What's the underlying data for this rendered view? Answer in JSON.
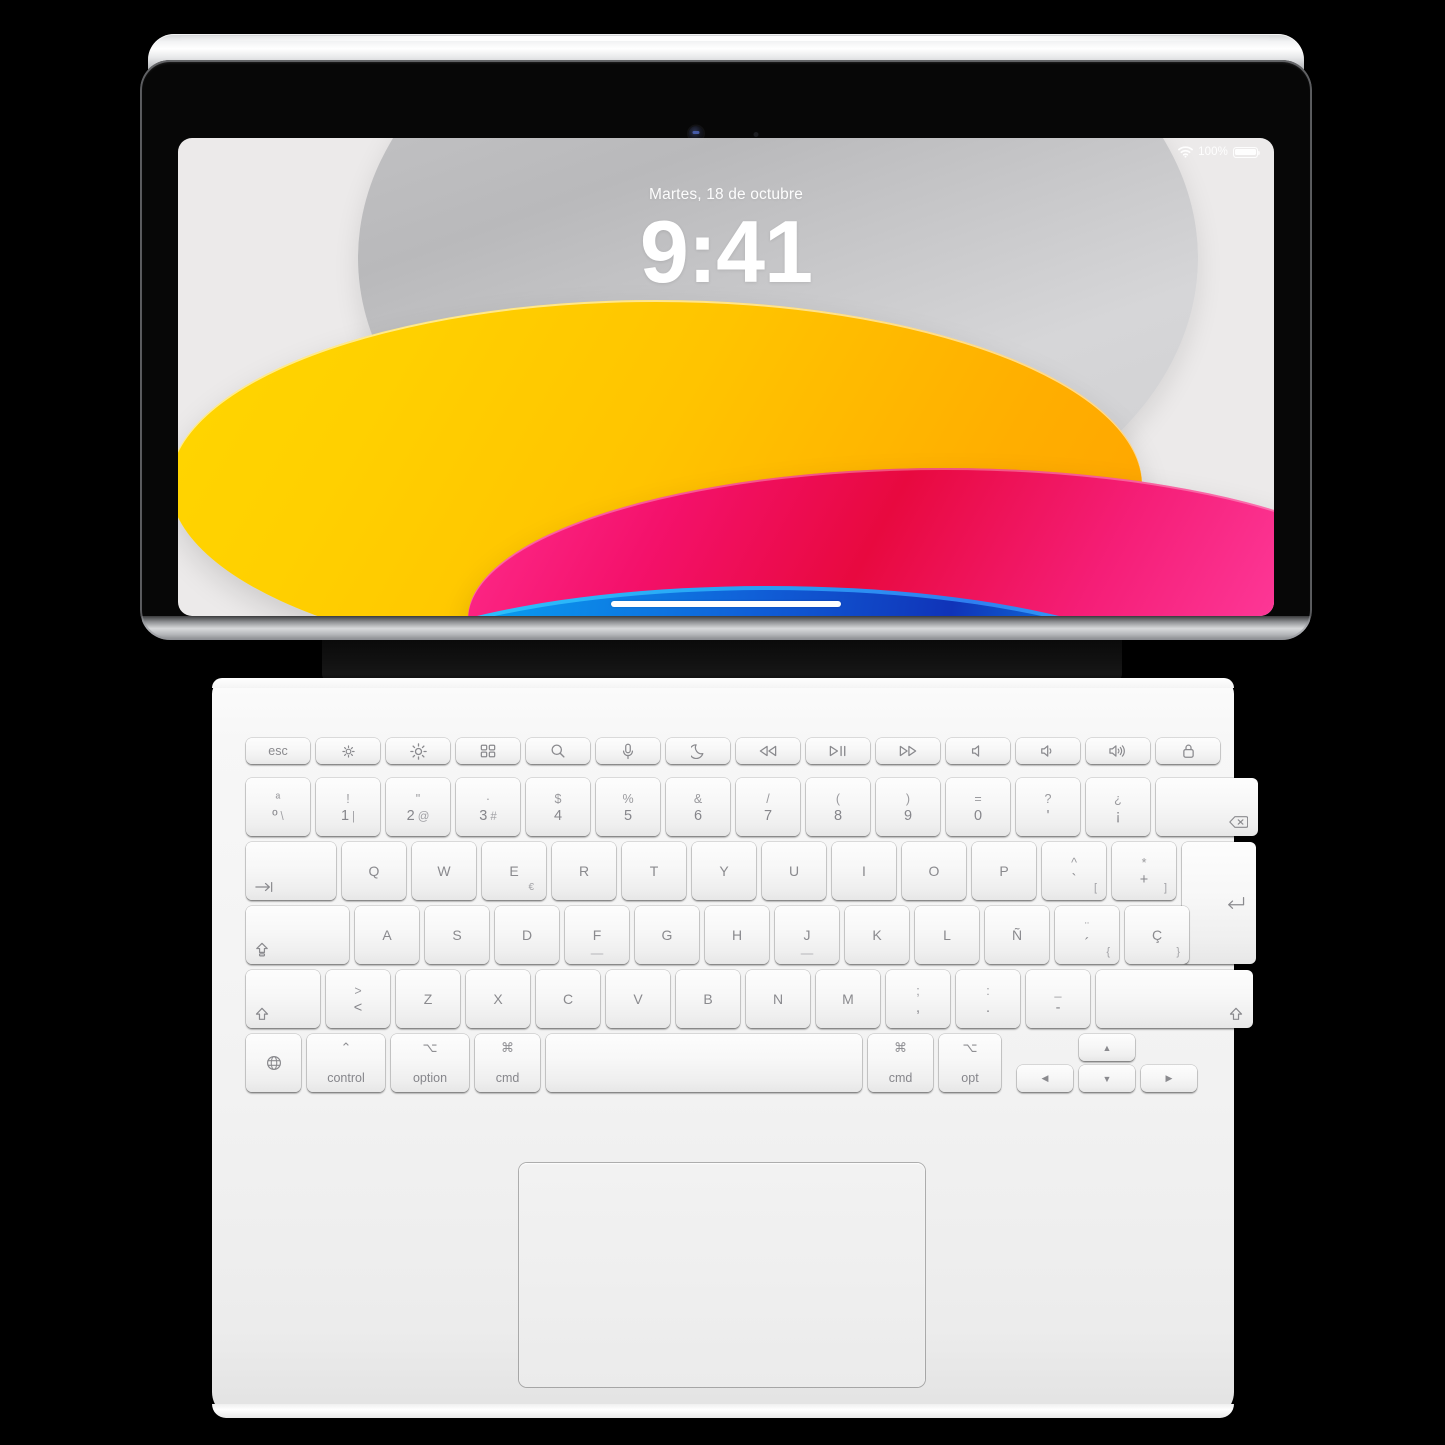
{
  "device": {
    "name": "iPad with Magic Keyboard Folio",
    "side_buttons": [
      "volume-up",
      "volume-down"
    ],
    "camera": "front-camera",
    "sensor": "ambient-light-sensor"
  },
  "lock_screen": {
    "date": "Martes, 18 de octubre",
    "time": "9:41",
    "status_bar": {
      "wifi_icon": "wifi-icon",
      "battery_percent": "100%",
      "battery_icon": "battery-full-icon"
    },
    "home_indicator": "home-indicator",
    "wallpaper": {
      "name": "iPad 10th generation abstract ellipses",
      "colors": {
        "gray": "#c9c9cb",
        "yellow": "#ffd600",
        "orange": "#ffa300",
        "pink": "#ff2d8e",
        "crimson": "#e8093f",
        "blue": "#1060d8",
        "cyan": "#00bff5"
      }
    }
  },
  "keyboard": {
    "layout": "Spanish",
    "function_row": [
      {
        "label": "esc",
        "icon": "",
        "name": "key-esc"
      },
      {
        "label": "",
        "icon": "brightness-down-icon",
        "name": "key-brightness-down"
      },
      {
        "label": "",
        "icon": "brightness-up-icon",
        "name": "key-brightness-up"
      },
      {
        "label": "",
        "icon": "grid-icon",
        "name": "key-home-grid"
      },
      {
        "label": "",
        "icon": "search-icon",
        "name": "key-search"
      },
      {
        "label": "",
        "icon": "microphone-icon",
        "name": "key-dictation"
      },
      {
        "label": "",
        "icon": "moon-icon",
        "name": "key-do-not-disturb"
      },
      {
        "label": "",
        "icon": "rewind-icon",
        "name": "key-rewind"
      },
      {
        "label": "",
        "icon": "play-pause-icon",
        "name": "key-play-pause"
      },
      {
        "label": "",
        "icon": "fast-forward-icon",
        "name": "key-fast-forward"
      },
      {
        "label": "",
        "icon": "mute-icon",
        "name": "key-mute"
      },
      {
        "label": "",
        "icon": "volume-down-icon",
        "name": "key-volume-down"
      },
      {
        "label": "",
        "icon": "volume-up-icon",
        "name": "key-volume-up"
      },
      {
        "label": "",
        "icon": "lock-icon",
        "name": "key-lock"
      }
    ],
    "number_row": [
      {
        "top": "ª",
        "bottom": "º",
        "alt": "\\",
        "name": "key-ordinal"
      },
      {
        "top": "!",
        "bottom": "1",
        "alt": "|",
        "name": "key-1"
      },
      {
        "top": "\"",
        "bottom": "2",
        "alt": "@",
        "name": "key-2"
      },
      {
        "top": "·",
        "bottom": "3",
        "alt": "#",
        "name": "key-3"
      },
      {
        "top": "$",
        "bottom": "4",
        "alt": "",
        "name": "key-4"
      },
      {
        "top": "%",
        "bottom": "5",
        "alt": "",
        "name": "key-5"
      },
      {
        "top": "&",
        "bottom": "6",
        "alt": "",
        "name": "key-6"
      },
      {
        "top": "/",
        "bottom": "7",
        "alt": "",
        "name": "key-7"
      },
      {
        "top": "(",
        "bottom": "8",
        "alt": "",
        "name": "key-8"
      },
      {
        "top": ")",
        "bottom": "9",
        "alt": "",
        "name": "key-9"
      },
      {
        "top": "=",
        "bottom": "0",
        "alt": "",
        "name": "key-0"
      },
      {
        "top": "?",
        "bottom": "'",
        "alt": "",
        "name": "key-question"
      },
      {
        "top": "¿",
        "bottom": "¡",
        "alt": "",
        "name": "key-inverted"
      }
    ],
    "delete_key": {
      "icon": "delete-icon",
      "name": "key-delete"
    },
    "tab_key": {
      "icon": "tab-icon",
      "name": "key-tab"
    },
    "top_letter_row": [
      "Q",
      "W",
      "E",
      "R",
      "T",
      "Y",
      "U",
      "I",
      "O",
      "P"
    ],
    "e_subscript": "€",
    "bracket_keys": [
      {
        "top": "^",
        "bottom": "`",
        "brk": "[",
        "name": "key-circumflex"
      },
      {
        "top": "*",
        "bottom": "+",
        "brk": "]",
        "name": "key-plus"
      }
    ],
    "return_key": {
      "icon": "return-icon",
      "name": "key-return"
    },
    "caps_lock_key": {
      "icon": "caps-lock-icon",
      "name": "key-caps-lock"
    },
    "home_letter_row": [
      "A",
      "S",
      "D",
      "F",
      "G",
      "H",
      "J",
      "K",
      "L",
      "Ñ"
    ],
    "accent_keys": [
      {
        "top": "¨",
        "bottom": "´",
        "brk": "{",
        "name": "key-diaeresis"
      },
      {
        "top": "",
        "bottom": "Ç",
        "brk": "}",
        "name": "key-cedilla"
      }
    ],
    "left_shift_key": {
      "icon": "shift-icon",
      "name": "key-shift-left"
    },
    "angle_key": {
      "top": ">",
      "bottom": "<",
      "name": "key-angle-brackets"
    },
    "bottom_letter_row": [
      "Z",
      "X",
      "C",
      "V",
      "B",
      "N",
      "M"
    ],
    "punct_keys": [
      {
        "top": ";",
        "bottom": ",",
        "name": "key-comma"
      },
      {
        "top": ":",
        "bottom": ".",
        "name": "key-period"
      },
      {
        "top": "_",
        "bottom": "-",
        "name": "key-hyphen"
      }
    ],
    "right_shift_key": {
      "icon": "shift-icon",
      "name": "key-shift-right"
    },
    "modifier_row": {
      "globe": {
        "icon": "globe-icon",
        "name": "key-globe"
      },
      "control": {
        "symbol": "⌃",
        "label": "control",
        "name": "key-control"
      },
      "option_left": {
        "symbol": "⌥",
        "label": "option",
        "name": "key-option-left"
      },
      "cmd_left": {
        "symbol": "⌘",
        "label": "cmd",
        "name": "key-cmd-left"
      },
      "space": {
        "label": "",
        "name": "key-space"
      },
      "cmd_right": {
        "symbol": "⌘",
        "label": "cmd",
        "name": "key-cmd-right"
      },
      "option_right": {
        "symbol": "⌥",
        "label": "opt",
        "name": "key-option-right"
      },
      "arrow_left": {
        "glyph": "◀",
        "name": "key-arrow-left"
      },
      "arrow_up": {
        "glyph": "▲",
        "name": "key-arrow-up"
      },
      "arrow_down": {
        "glyph": "▼",
        "name": "key-arrow-down"
      },
      "arrow_right": {
        "glyph": "▶",
        "name": "key-arrow-right"
      }
    },
    "trackpad": {
      "name": "trackpad"
    }
  }
}
